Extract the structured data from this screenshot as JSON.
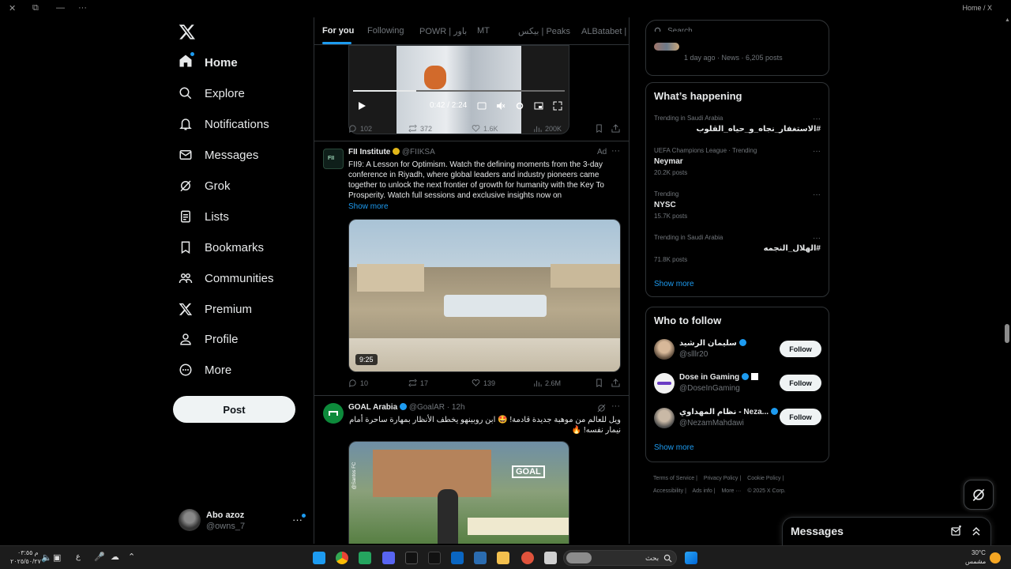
{
  "window": {
    "title": "Home / X"
  },
  "nav": {
    "items": [
      {
        "label": "Home",
        "icon": "home-icon"
      },
      {
        "label": "Explore",
        "icon": "search-icon"
      },
      {
        "label": "Notifications",
        "icon": "bell-icon"
      },
      {
        "label": "Messages",
        "icon": "envelope-icon"
      },
      {
        "label": "Grok",
        "icon": "grok-icon"
      },
      {
        "label": "Lists",
        "icon": "list-icon"
      },
      {
        "label": "Bookmarks",
        "icon": "bookmark-icon"
      },
      {
        "label": "Communities",
        "icon": "people-icon"
      },
      {
        "label": "Premium",
        "icon": "x-logo-icon"
      },
      {
        "label": "Profile",
        "icon": "user-icon"
      },
      {
        "label": "More",
        "icon": "more-circle-icon"
      }
    ],
    "post_label": "Post"
  },
  "account": {
    "name": "Abo azoz",
    "handle": "@owns_7"
  },
  "tabs": [
    "For you",
    "Following",
    "POWR | باور",
    "MT",
    "بيكس | Peaks",
    "ALBatabet | ل"
  ],
  "tweet1": {
    "video_time": "0:42 / 2:24",
    "stats": {
      "replies": "102",
      "reposts": "372",
      "likes": "1.6K",
      "views": "200K"
    }
  },
  "tweet2": {
    "name": "FII Institute",
    "handle": "@FIIKSA",
    "ad_label": "Ad",
    "body": "FII9: A Lesson for Optimism. Watch the defining moments from the 3-day conference in Riyadh, where global leaders and industry pioneers came together to unlock the next frontier of growth for humanity with the Key To Prosperity. Watch full sessions and exclusive insights now on",
    "show_more": "Show more",
    "video_duration": "9:25",
    "stats": {
      "replies": "10",
      "reposts": "17",
      "likes": "139",
      "views": "2.6M"
    }
  },
  "tweet3": {
    "name": "GOAL Arabia",
    "handle": "@GoalAR",
    "time": "· 12h",
    "body": "ويل للعالم من موهبة جديدة قادمة! 🤩 ابن روبينهو يخطف الأنظار بمهارة ساحرة أمام نيمار نفسه! 🔥",
    "media_goal_label": "GOAL",
    "media_watermark": "@Santos FC"
  },
  "right": {
    "search_placeholder": "Search",
    "news_meta": "1 day ago · News · 6,205 posts",
    "whats_happening": "What’s happening",
    "trends": [
      {
        "context": "Trending in Saudi Arabia",
        "name": "#الاستغفار_نجاه_و_حياه_القلوب",
        "count": ""
      },
      {
        "context": "UEFA Champions League · Trending",
        "name": "Neymar",
        "count": "20.2K posts"
      },
      {
        "context": "Trending",
        "name": "NYSC",
        "count": "15.7K posts"
      },
      {
        "context": "Trending in Saudi Arabia",
        "name": "#الهلال_النجمه",
        "count": "71.8K posts"
      }
    ],
    "show_more": "Show more",
    "who_to_follow": "Who to follow",
    "follow_suggestions": [
      {
        "name": "سليمان الرشيد",
        "handle": "@slllr20",
        "button": "Follow"
      },
      {
        "name": "Dose in Gaming",
        "handle": "@DoseInGaming",
        "button": "Follow"
      },
      {
        "name": "نظام المهداوي - Neza...",
        "handle": "@NezamMahdawi",
        "button": "Follow"
      }
    ],
    "show_more_2": "Show more",
    "footer": [
      "Terms of Service |",
      "Privacy Policy |",
      "Cookie Policy |",
      "Accessibility |",
      "Ads info |",
      "More ···",
      "© 2025 X Corp."
    ]
  },
  "messages_drawer": {
    "label": "Messages"
  },
  "taskbar": {
    "time": "م ٠٣:٥٥",
    "date": "٢٠٢٥/٥٠/٢٧",
    "lang": "ع",
    "search_text": "بحث",
    "weather_temp": "30°C",
    "weather_desc": "مشمس"
  },
  "colors": {
    "accent": "#1d9bf0",
    "background": "#000000",
    "border": "#2f3336",
    "muted": "#71767b"
  }
}
